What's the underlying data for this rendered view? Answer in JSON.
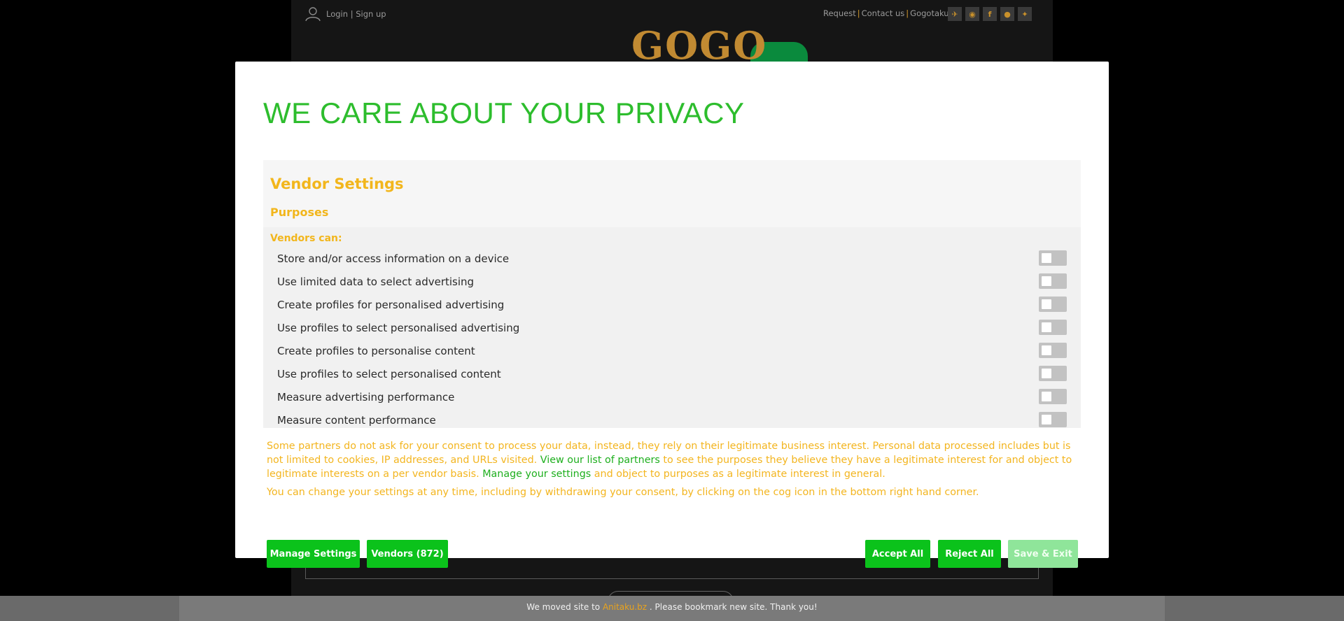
{
  "site": {
    "login": "Login",
    "login_sep": "|",
    "signup": "Sign up",
    "top_links": [
      "Request",
      "Contact us",
      "Gogotaku"
    ],
    "logo_text": "GOGO",
    "socials": [
      {
        "name": "telegram-icon",
        "glyph": "✈"
      },
      {
        "name": "discord-icon",
        "glyph": "◉"
      },
      {
        "name": "facebook-icon",
        "glyph": "f"
      },
      {
        "name": "reddit-icon",
        "glyph": "●"
      },
      {
        "name": "twitter-icon",
        "glyph": "✦"
      }
    ]
  },
  "modal": {
    "title": "WE CARE ABOUT YOUR PRIVACY",
    "vendor_settings_title": "Vendor Settings",
    "purposes_title": "Purposes",
    "vendors_can": "Vendors can:",
    "purposes": [
      "Store and/or access information on a device",
      "Use limited data to select advertising",
      "Create profiles for personalised advertising",
      "Use profiles to select personalised advertising",
      "Create profiles to personalise content",
      "Use profiles to select personalised content",
      "Measure advertising performance",
      "Measure content performance"
    ],
    "legit_text_1": "Some partners do not ask for your consent to process your data, instead, they rely on their legitimate business interest. Personal data processed includes but is not limited to cookies, IP addresses, and URLs visited. ",
    "legit_link_1": "View our list of partners",
    "legit_text_2": " to see the purposes they believe they have a legitimate interest for and object to legitimate interests on a per vendor basis. ",
    "legit_link_2": "Manage your settings",
    "legit_text_3": " and object to purposes as a legitimate interest in general.",
    "change_text": "You can change your settings at any time, including by withdrawing your consent, by clicking on the cog icon in the bottom right hand corner.",
    "buttons": {
      "manage": "Manage Settings",
      "vendors": "Vendors (872)",
      "accept": "Accept All",
      "reject": "Reject All",
      "save": "Save & Exit"
    }
  },
  "notice": {
    "prefix": "We moved site to ",
    "link": "Anitaku.bz",
    "suffix": " . Please bookmark new site. Thank you!"
  },
  "colors": {
    "accent_green": "#0bc21b",
    "title_green": "#2dbd2d",
    "accent_yellow": "#f2b61c"
  }
}
